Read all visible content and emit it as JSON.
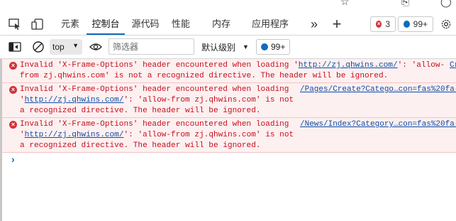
{
  "tabs": {
    "items": [
      {
        "label": "元素"
      },
      {
        "label": "控制台"
      },
      {
        "label": "源代码"
      },
      {
        "label": "性能"
      },
      {
        "label": "内存"
      },
      {
        "label": "应用程序"
      }
    ],
    "active_index": 1,
    "more_label": "»",
    "add_label": "+",
    "error_count": "3",
    "message_count": "99+"
  },
  "toolbar": {
    "context_value": "top",
    "filter_placeholder": "筛选器",
    "levels_label": "默认级别",
    "issues_count": "99+"
  },
  "messages": [
    {
      "line1_pre": "Invalid 'X-Frame-Options' header encountered when loading '",
      "line1_link": "http://zj.qhwins.com/",
      "line1_post": "': 'allow-",
      "line2": "from zj.qhwins.com' is not a recognized directive. The header will be ignored.",
      "source": "Cr"
    },
    {
      "line1": "Invalid 'X-Frame-Options' header encountered when loading",
      "line2_pre": "'",
      "line2_link": "http://zj.qhwins.com/",
      "line2_post": "': 'allow-from zj.qhwins.com' is not",
      "line3": "a recognized directive. The header will be ignored.",
      "source": "/Pages/Create?Catego…con=fas%20fa-"
    },
    {
      "line1": "Invalid 'X-Frame-Options' header encountered when loading",
      "line2_pre": "'",
      "line2_link": "http://zj.qhwins.com/",
      "line2_post": "': 'allow-from zj.qhwins.com' is not",
      "line3": "a recognized directive. The header will be ignored.",
      "source": "/News/Index?Category…con=fas%20fa-"
    }
  ],
  "prompt_symbol": "›",
  "colors": {
    "error_text": "#c50f1f",
    "error_bg": "#fdf0f0",
    "link": "#0e4da8",
    "accent": "#0f6cbd"
  }
}
